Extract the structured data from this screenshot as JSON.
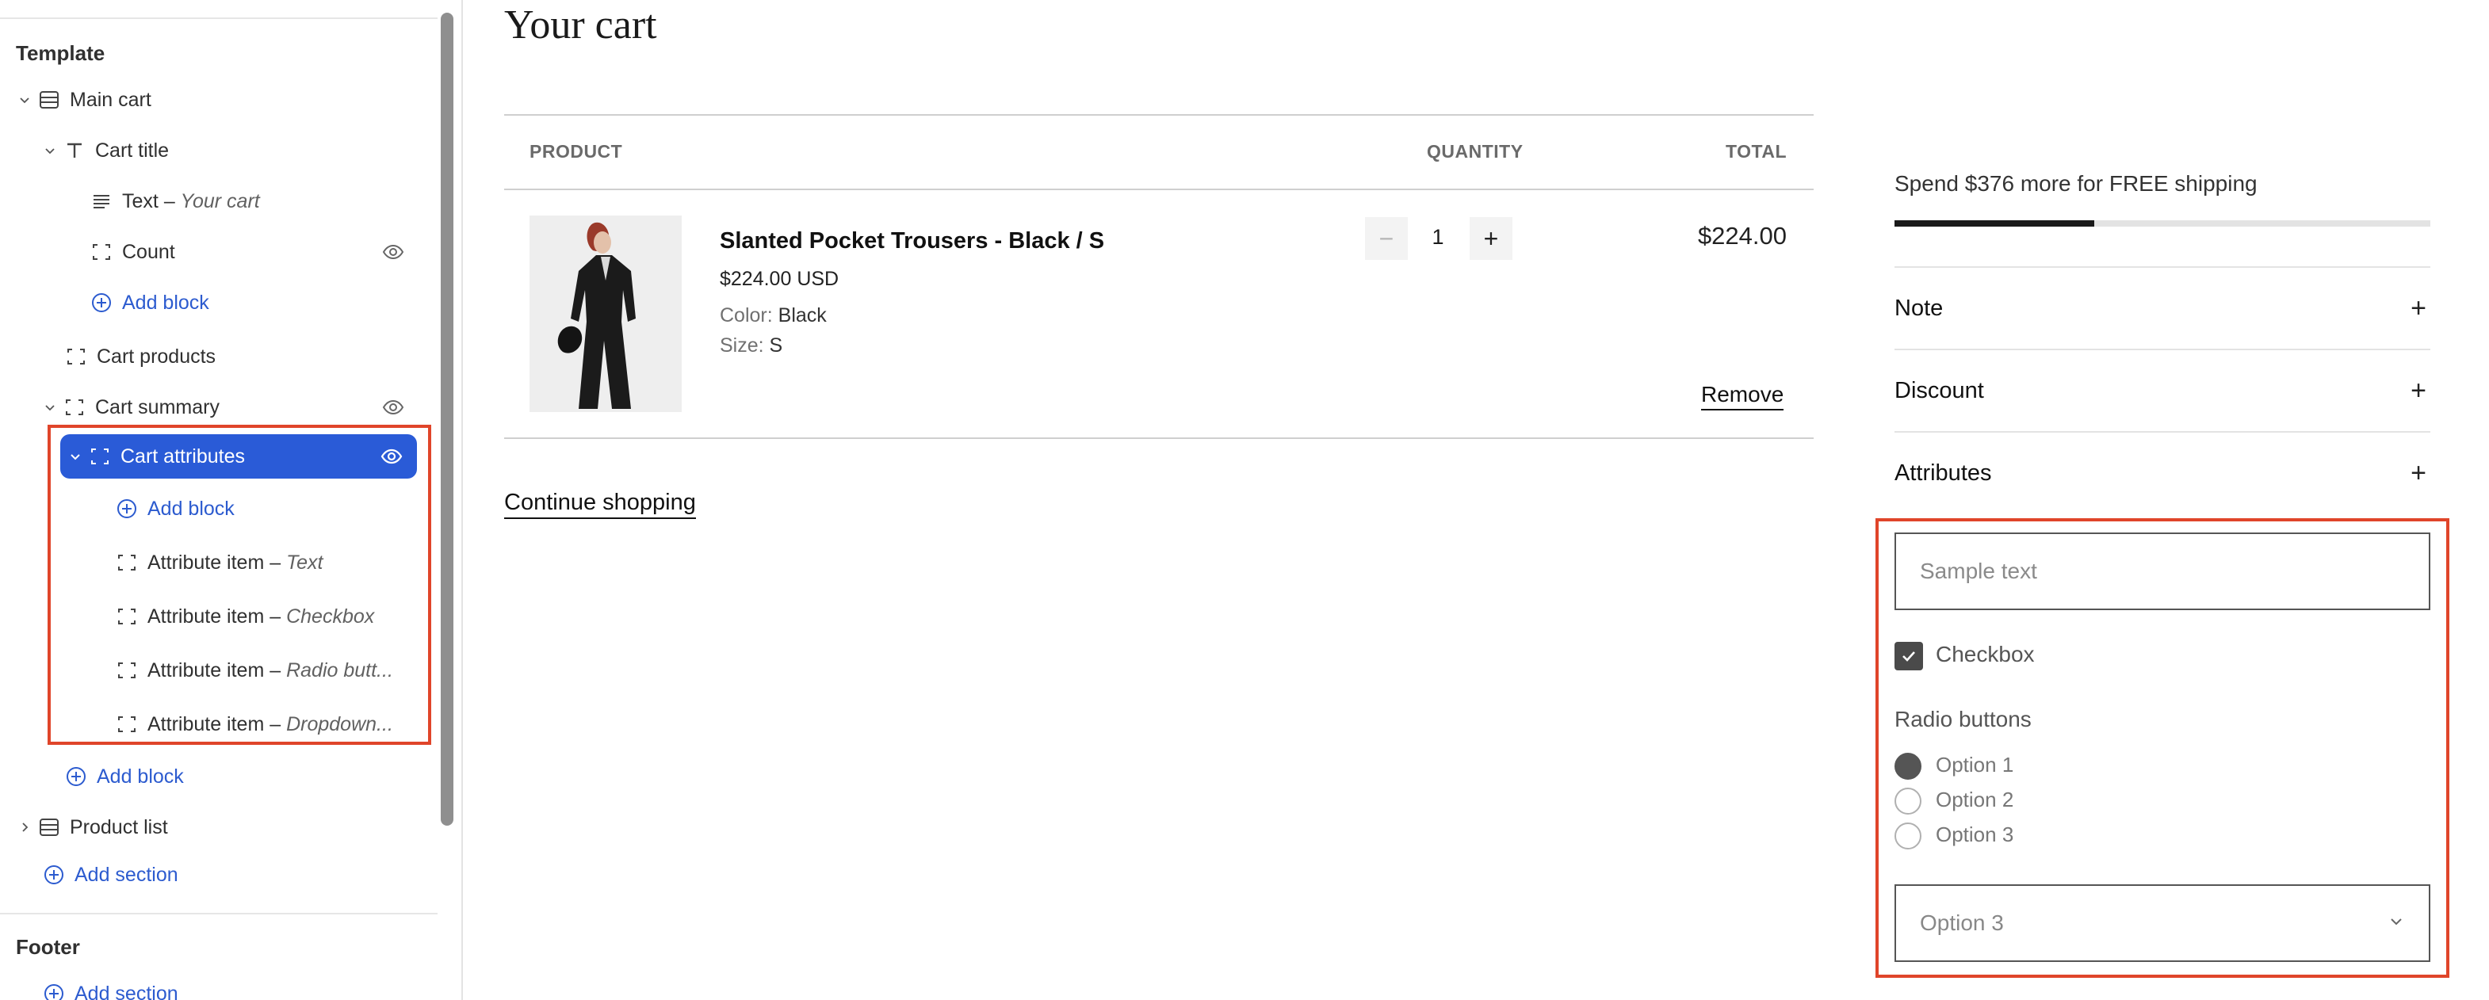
{
  "sidebar": {
    "template_heading": "Template",
    "footer_heading": "Footer",
    "items": {
      "main_cart": "Main cart",
      "cart_title": "Cart title",
      "text_block": "Text",
      "text_block_value": "Your cart",
      "count": "Count",
      "add_block_1": "Add block",
      "cart_products": "Cart products",
      "cart_summary": "Cart summary",
      "cart_attributes": "Cart attributes",
      "add_block_2": "Add block",
      "attribute_item": "Attribute item",
      "attr_text": "Text",
      "attr_checkbox": "Checkbox",
      "attr_radio": "Radio butt...",
      "attr_dropdown": "Dropdown...",
      "add_block_3": "Add block",
      "product_list": "Product list",
      "add_section": "Add section",
      "footer_add_section": "Add section"
    },
    "separator": "–"
  },
  "cart": {
    "title": "Your cart",
    "columns": {
      "product": "PRODUCT",
      "quantity": "QUANTITY",
      "total": "TOTAL"
    },
    "item": {
      "name": "Slanted Pocket Trousers - Black / S",
      "price": "$224.00 USD",
      "color_label": "Color:",
      "color_value": "Black",
      "size_label": "Size:",
      "size_value": "S",
      "quantity": "1",
      "total": "$224.00",
      "remove_label": "Remove"
    },
    "continue_label": "Continue shopping"
  },
  "summary": {
    "shipping_message": "Spend $376 more for FREE shipping",
    "shipping_progress": 0.373,
    "accordions": [
      "Note",
      "Discount",
      "Attributes"
    ],
    "text_placeholder": "Sample text",
    "checkbox_label": "Checkbox",
    "checkbox_checked": true,
    "radio_title": "Radio buttons",
    "radio_options": [
      "Option 1",
      "Option 2",
      "Option 3"
    ],
    "radio_selected": 0,
    "dropdown_value": "Option 3"
  },
  "colors": {
    "selected_bg": "#2a5bd7",
    "link": "#2c5bcf",
    "highlight_border": "#e0452a"
  }
}
